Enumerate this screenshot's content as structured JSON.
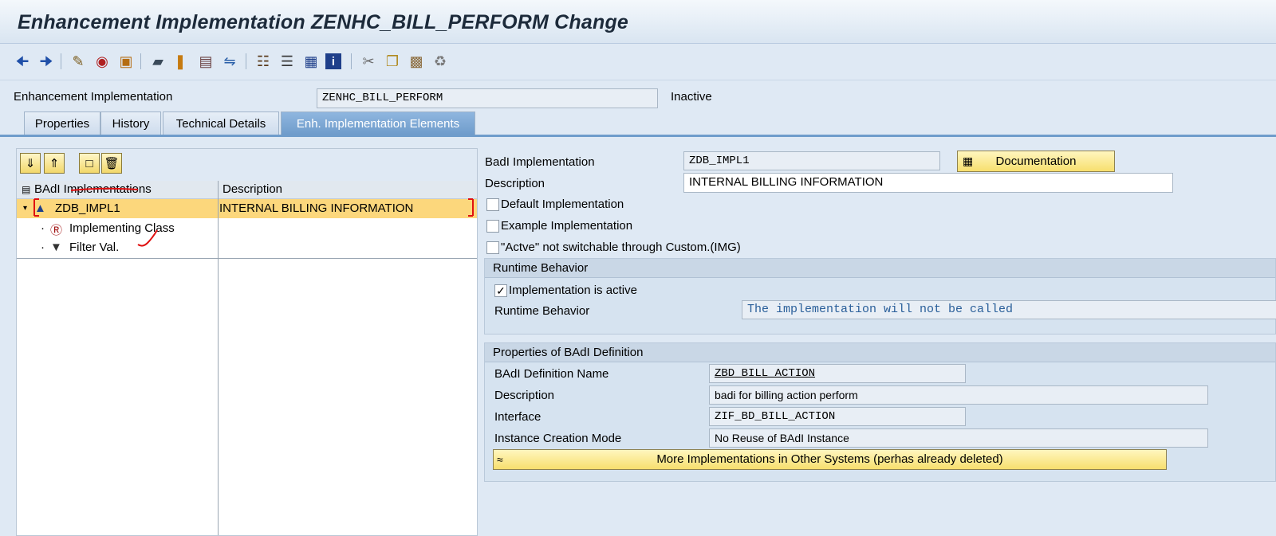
{
  "title": "Enhancement Implementation ZENHC_BILL_PERFORM Change",
  "toolbar": {
    "icons": [
      "back-icon",
      "forward-icon",
      "display-change-icon",
      "other-object-icon",
      "activate-icon",
      "check-icon",
      "where-used-icon",
      "enhancement-icon",
      "layout-icon",
      "navigation-window-icon",
      "object-list-icon",
      "hierarchy-icon",
      "documentation-icon",
      "info-icon",
      "cut-icon",
      "copy-icon",
      "paste-icon",
      "undo-icon"
    ]
  },
  "header": {
    "label": "Enhancement Implementation",
    "value": "ZENHC_BILL_PERFORM",
    "status": "Inactive"
  },
  "tabs": [
    {
      "label": "Properties"
    },
    {
      "label": "History"
    },
    {
      "label": "Technical Details"
    },
    {
      "label": "Enh. Implementation Elements"
    }
  ],
  "tree": {
    "col1": "BAdI Implementations",
    "col2": "Description",
    "rows": [
      {
        "label": "ZDB_IMPL1",
        "desc": "INTERNAL BILLING INFORMATION"
      },
      {
        "label": "Implementing Class",
        "desc": ""
      },
      {
        "label": "Filter Val.",
        "desc": ""
      }
    ]
  },
  "right": {
    "badi_impl_label": "BadI Implementation",
    "badi_impl_value": "ZDB_IMPL1",
    "doc_button": "Documentation",
    "desc_label": "Description",
    "desc_value": "INTERNAL BILLING INFORMATION",
    "default_impl": "Default Implementation",
    "example_impl": "Example Implementation",
    "not_switchable": "\"Actve\" not switchable through Custom.(IMG)",
    "runtime": {
      "header": "Runtime Behavior",
      "active_label": "Implementation is active",
      "active_checked": true,
      "behavior_label": "Runtime Behavior",
      "behavior_value": "The implementation will not be called"
    },
    "props": {
      "header": "Properties of BAdI Definition",
      "def_name_label": "BAdI Definition Name",
      "def_name_value": "ZBD_BILL_ACTION",
      "desc_label": "Description",
      "desc_value": "badi for billing action perform",
      "interface_label": "Interface",
      "interface_value": "ZIF_BD_BILL_ACTION",
      "instance_label": "Instance Creation Mode",
      "instance_value": "No Reuse of BAdI Instance",
      "more_button": "More Implementations in Other Systems (perhas already deleted)"
    }
  },
  "colors": {
    "accent": "#6f9ccb",
    "button_yellow": "#f7df6e",
    "selection": "#fcd77c",
    "annotation_red": "#e01010"
  }
}
